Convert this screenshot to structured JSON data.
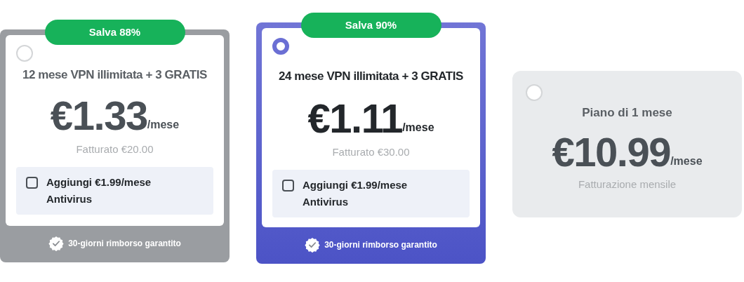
{
  "plans": [
    {
      "kind": "framed",
      "selected": false,
      "badge": "Salva 88%",
      "title": "12 mese VPN illimitata + 3 GRATIS",
      "price": "€1.33",
      "per": "/mese",
      "billing": "Fatturato €20.00",
      "addon": {
        "checked": false,
        "line1": "Aggiungi €1.99/mese",
        "line2": "Antivirus"
      },
      "footer": "30-giorni rimborso garantito"
    },
    {
      "kind": "framed",
      "selected": true,
      "badge": "Salva 90%",
      "title": "24 mese VPN illimitata + 3 GRATIS",
      "price": "€1.11",
      "per": "/mese",
      "billing": "Fatturato €30.00",
      "addon": {
        "checked": false,
        "line1": "Aggiungi €1.99/mese",
        "line2": "Antivirus"
      },
      "footer": "30-giorni rimborso garantito"
    },
    {
      "kind": "plain",
      "selected": false,
      "title": "Piano di 1 mese",
      "price": "€10.99",
      "per": "/mese",
      "billing": "Fatturazione mensile"
    }
  ]
}
